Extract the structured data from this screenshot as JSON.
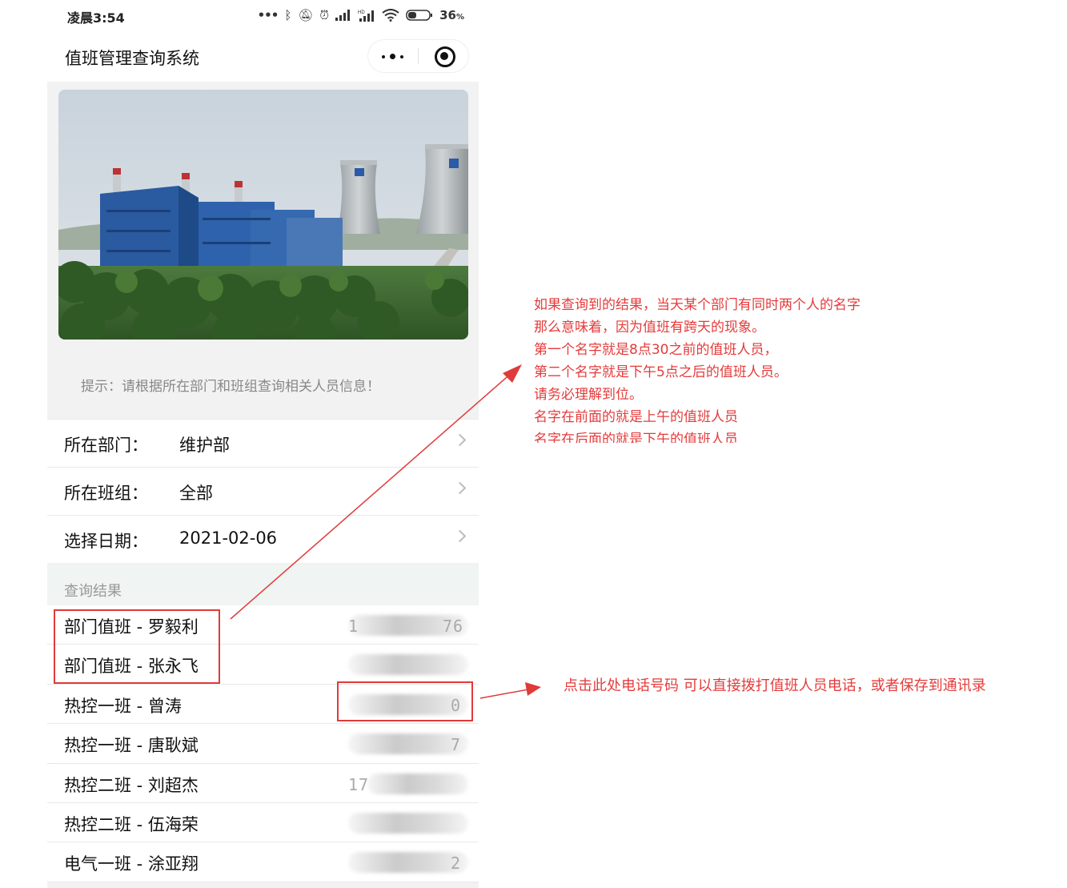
{
  "status_bar": {
    "time": "凌晨3:54",
    "icons": [
      "more-dots-icon",
      "bluetooth-icon",
      "mute-bell-icon",
      "alarm-icon",
      "signal-icon",
      "hd-signal-icon",
      "wifi-icon",
      "battery-icon"
    ],
    "battery": "36"
  },
  "nav": {
    "title": "值班管理查询系统"
  },
  "banner": {
    "description_icon": "power-plant-photo"
  },
  "tip": "提示：请根据所在部门和班组查询相关人员信息！",
  "form": {
    "rows": [
      {
        "label": "所在部门：",
        "value": "维护部"
      },
      {
        "label": "所在班组：",
        "value": "全部"
      },
      {
        "label": "选择日期：",
        "value": "2021-02-06"
      }
    ]
  },
  "results": {
    "title": "查询结果",
    "rows": [
      {
        "name": "部门值班 - 罗毅利",
        "phone": "1",
        "phone_tail": "76"
      },
      {
        "name": "部门值班 - 张永飞",
        "phone": "",
        "phone_tail": ""
      },
      {
        "name": "热控一班 - 曾涛",
        "phone": "",
        "phone_tail": "0"
      },
      {
        "name": "热控一班 - 唐耿斌",
        "phone": "",
        "phone_tail": "7"
      },
      {
        "name": "热控二班 - 刘超杰",
        "phone": "17",
        "phone_tail": ""
      },
      {
        "name": "热控二班 - 伍海荣",
        "phone": "",
        "phone_tail": ""
      },
      {
        "name": "电气一班 - 涂亚翔",
        "phone": "",
        "phone_tail": "2"
      }
    ]
  },
  "annotations": {
    "main_note": [
      "如果查询到的结果，当天某个部门有同时两个人的名字",
      "那么意味着，因为值班有跨天的现象。",
      "第一个名字就是8点30之前的值班人员，",
      "第二个名字就是下午5点之后的值班人员。",
      "请务必理解到位。",
      "名字在前面的就是上午的值班人员",
      "名字在后面的就是下午的值班人员"
    ],
    "phone_note": "点击此处电话号码 可以直接拨打值班人员电话，或者保存到通讯录",
    "color": "#e53b3b"
  }
}
